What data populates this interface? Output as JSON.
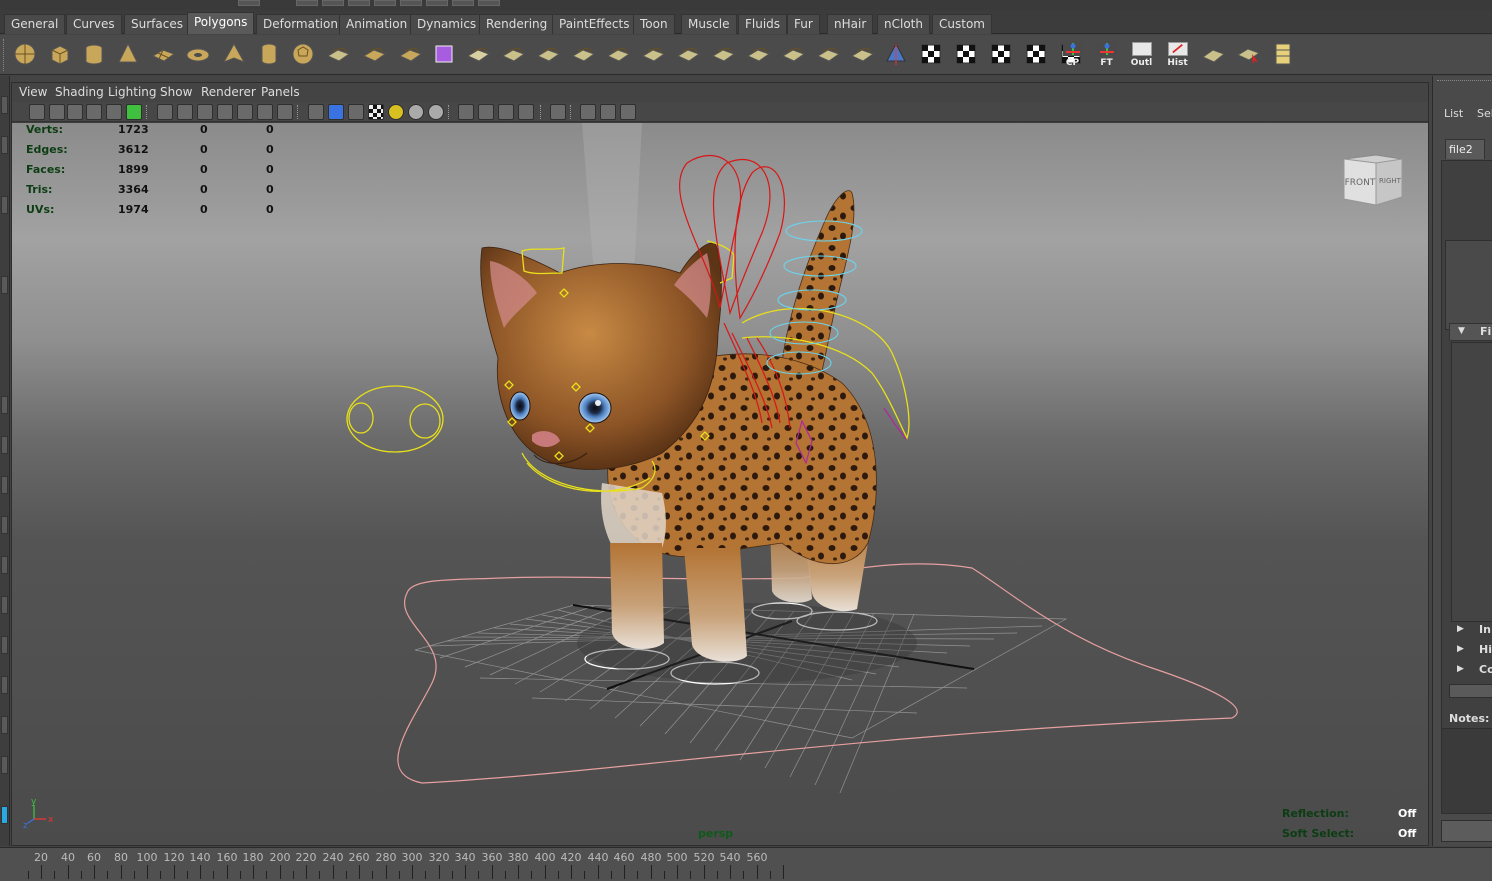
{
  "shelf_tabs": [
    "General",
    "Curves",
    "Surfaces",
    "Polygons",
    "Deformation",
    "Animation",
    "Dynamics",
    "Rendering",
    "PaintEffects",
    "Toon",
    "Muscle",
    "Fluids",
    "Fur",
    "nHair",
    "nCloth",
    "Custom"
  ],
  "active_shelf_tab": "Polygons",
  "shelf_icons": [
    "poly-sphere-icon",
    "poly-cube-icon",
    "poly-cylinder-icon",
    "poly-cone-icon",
    "poly-plane-icon",
    "poly-torus-icon",
    "poly-pyramid-icon",
    "poly-pipe-icon",
    "poly-soccer-ball-icon",
    "cut-uvs-icon",
    "poly-sphere-small-icon",
    "poly-sphere-smooth-icon",
    "combine-cube-icon",
    "uv-snapshot-icon",
    "select-uvs-icon",
    "extrude-face-icon",
    "bridge-icon",
    "split-icon",
    "wedge-icon",
    "bevel-icon",
    "append-icon",
    "smooth-icon",
    "crease-icon",
    "merge-icon",
    "mirror-icon",
    "sculpt-icon",
    "checker-1-icon",
    "checker-2-icon",
    "checker-3-icon",
    "checker-4-icon",
    "checker-5-icon"
  ],
  "shelf_text_icons": [
    "CP",
    "FT",
    "Outl",
    "Hist"
  ],
  "panel_menu": [
    "View",
    "Shading",
    "Lighting",
    "Show",
    "Renderer",
    "Panels"
  ],
  "hud_stats": [
    {
      "label": "Verts:",
      "v1": "1723",
      "v2": "0",
      "v3": "0"
    },
    {
      "label": "Edges:",
      "v1": "3612",
      "v2": "0",
      "v3": "0"
    },
    {
      "label": "Faces:",
      "v1": "1899",
      "v2": "0",
      "v3": "0"
    },
    {
      "label": "Tris:",
      "v1": "3364",
      "v2": "0",
      "v3": "0"
    },
    {
      "label": "UVs:",
      "v1": "1974",
      "v2": "0",
      "v3": "0"
    }
  ],
  "viewcube": {
    "front": "FRONT",
    "right": "RIGHT"
  },
  "camera_label": "persp",
  "hud_bottom_right": [
    {
      "label": "Reflection:",
      "value": "Off"
    },
    {
      "label": "Soft Select:",
      "value": "Off"
    }
  ],
  "axis": {
    "x": "x",
    "y": "y",
    "z": "z"
  },
  "right_panel": {
    "menu_list": "List",
    "menu_select": "Sele",
    "tab": "file2",
    "sections": [
      "Fil",
      "In",
      "Hi",
      "Co"
    ],
    "notes_label": "Notes:"
  },
  "timeline": {
    "labels": [
      "20",
      "40",
      "60",
      "80",
      "100",
      "120",
      "140",
      "160",
      "180",
      "200",
      "220",
      "240",
      "260",
      "280",
      "300",
      "320",
      "340",
      "360",
      "380",
      "400",
      "420",
      "440",
      "460",
      "480",
      "500",
      "520",
      "540",
      "560"
    ]
  },
  "colors": {
    "hud_green": "#0c3d12",
    "cat_fur": "#b8793a",
    "control_yellow": "#e8e01a",
    "control_red": "#d81616",
    "control_cyan": "#6ad4ee",
    "ground_curve": "#e6a0a0"
  }
}
